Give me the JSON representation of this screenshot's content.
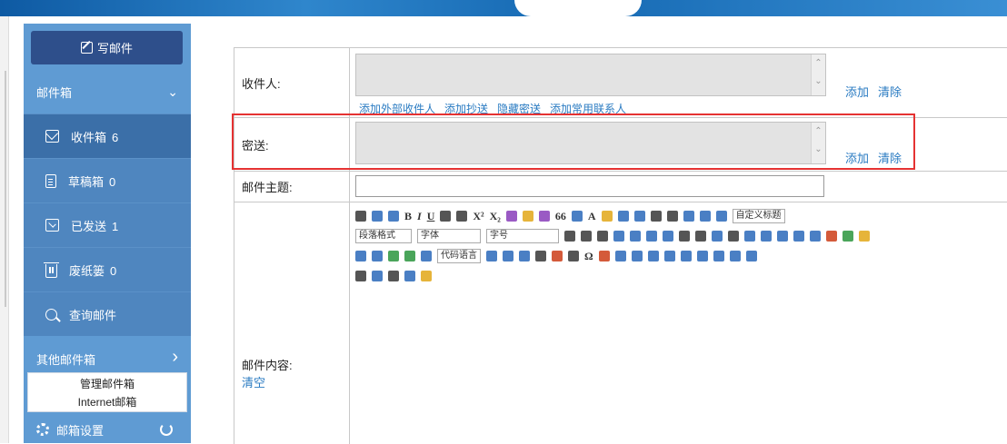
{
  "sidebar": {
    "compose_label": "写邮件",
    "mailbox_section": "邮件箱",
    "items": [
      {
        "label": "收件箱",
        "count": "6"
      },
      {
        "label": "草稿箱",
        "count": "0"
      },
      {
        "label": "已发送",
        "count": "1"
      },
      {
        "label": "废纸篓",
        "count": "0"
      },
      {
        "label": "查询邮件",
        "count": ""
      }
    ],
    "other_section": "其他邮件箱",
    "other_menu": [
      "管理邮件箱",
      "Internet邮箱"
    ],
    "settings_label": "邮箱设置"
  },
  "form": {
    "recipients_label": "收件人:",
    "bcc_label": "密送:",
    "subject_label": "邮件主题:",
    "content_label": "邮件内容:",
    "clear_content": "清空",
    "add_label": "添加",
    "clear_label": "清除",
    "recipient_links": [
      "添加外部收件人",
      "添加抄送",
      "隐藏密送",
      "添加常用联系人"
    ],
    "subject_value": ""
  },
  "toolbar": {
    "line1": {
      "custom_heading": "自定义标题"
    },
    "line2": {
      "paragraph": "段落格式",
      "font": "字体",
      "size": "字号"
    },
    "line3": {
      "code_lang": "代码语言"
    }
  },
  "colors": {
    "sidebar": "#5f9bd3",
    "active": "#3b6fa8",
    "compose": "#2e4f8b",
    "link": "#2a7bc2",
    "highlight": "#e53232"
  }
}
